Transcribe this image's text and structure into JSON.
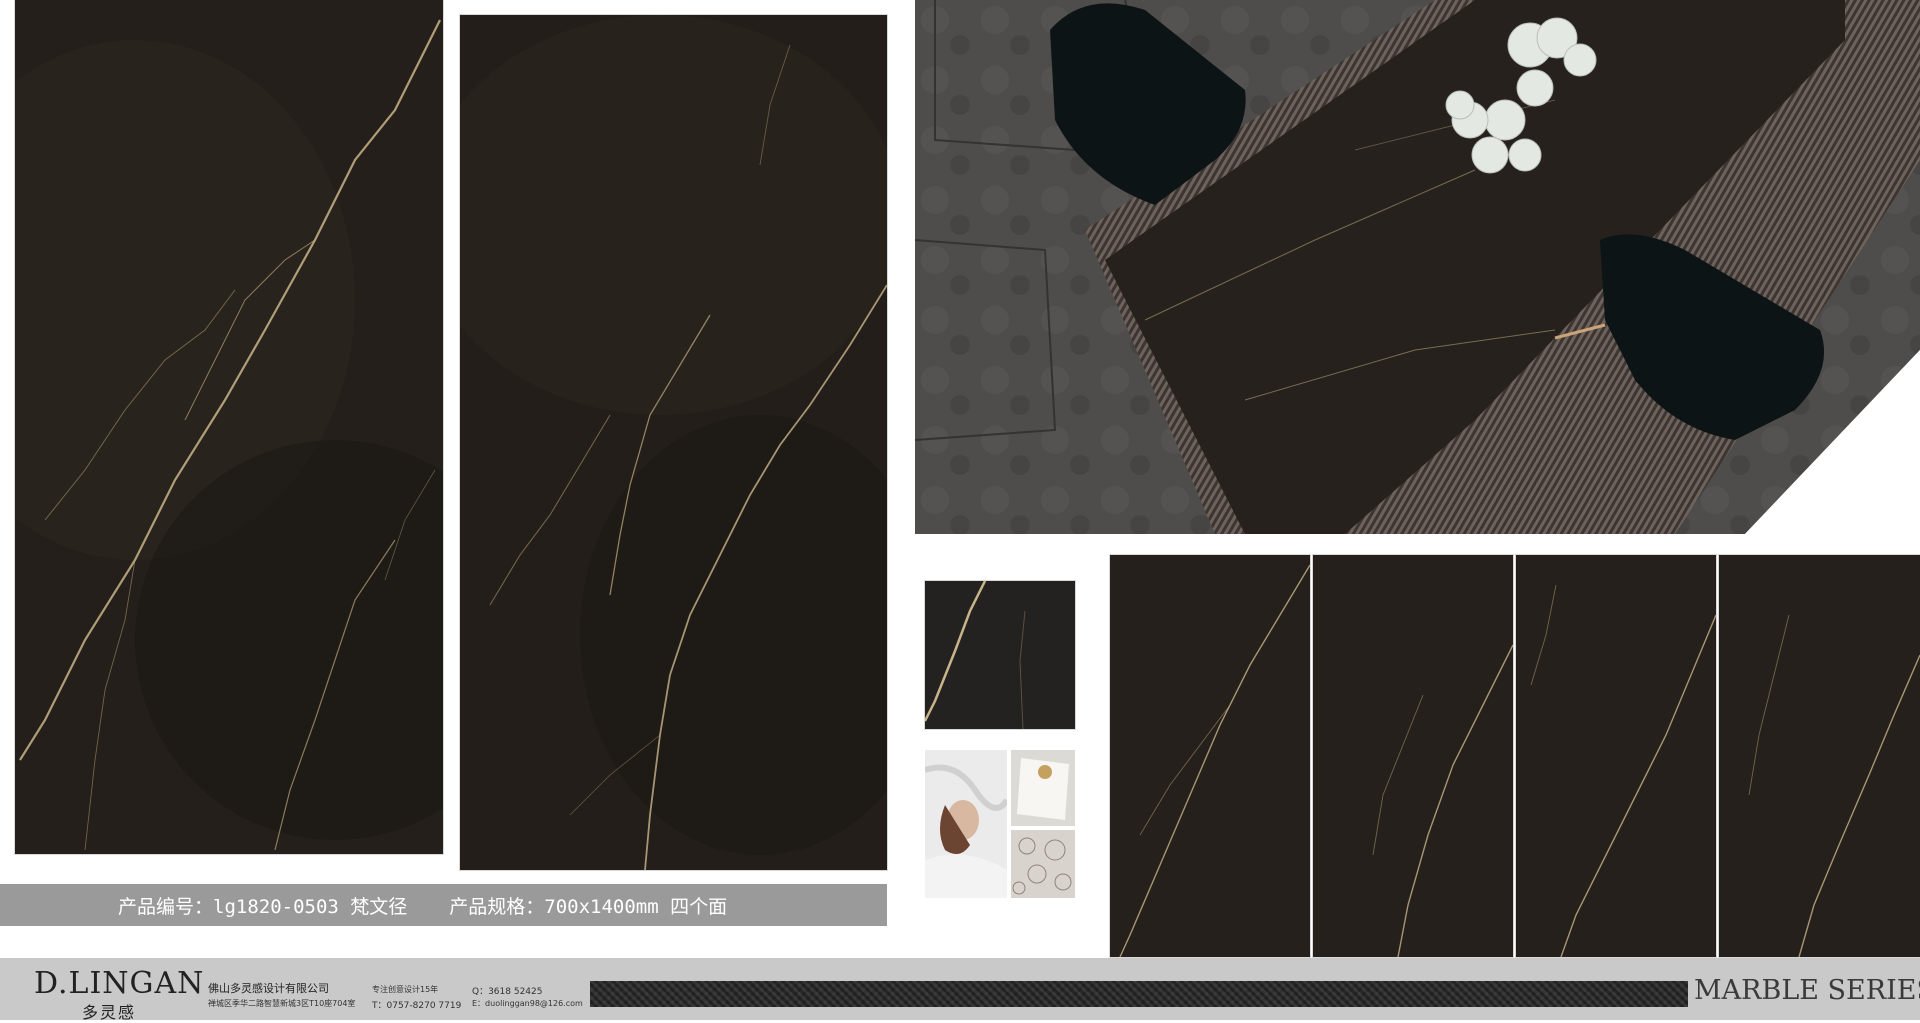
{
  "product_info": {
    "code": "产品编号：lg1820-0503 梵文径",
    "spec": "产品规格：700x1400mm  四个面"
  },
  "footer": {
    "brand_en": "D.LINGAN",
    "brand_cn": "多灵感",
    "company_name": "佛山多灵感设计有限公司",
    "address": "禅城区季华二路智慧新城3区T10座704室",
    "slogan": "专注创意设计15年",
    "tel": "T：0757-8270 7719",
    "qq": "Q：3618 52425",
    "email": "E：duolinggan98@126.com",
    "series": "MARBLE SERIES"
  },
  "colors": {
    "marble_base": "#241f1a",
    "marble_vein": "#c9b48a",
    "info_bar": "#9a9a9a",
    "footer_bg": "#c9c9c9"
  }
}
